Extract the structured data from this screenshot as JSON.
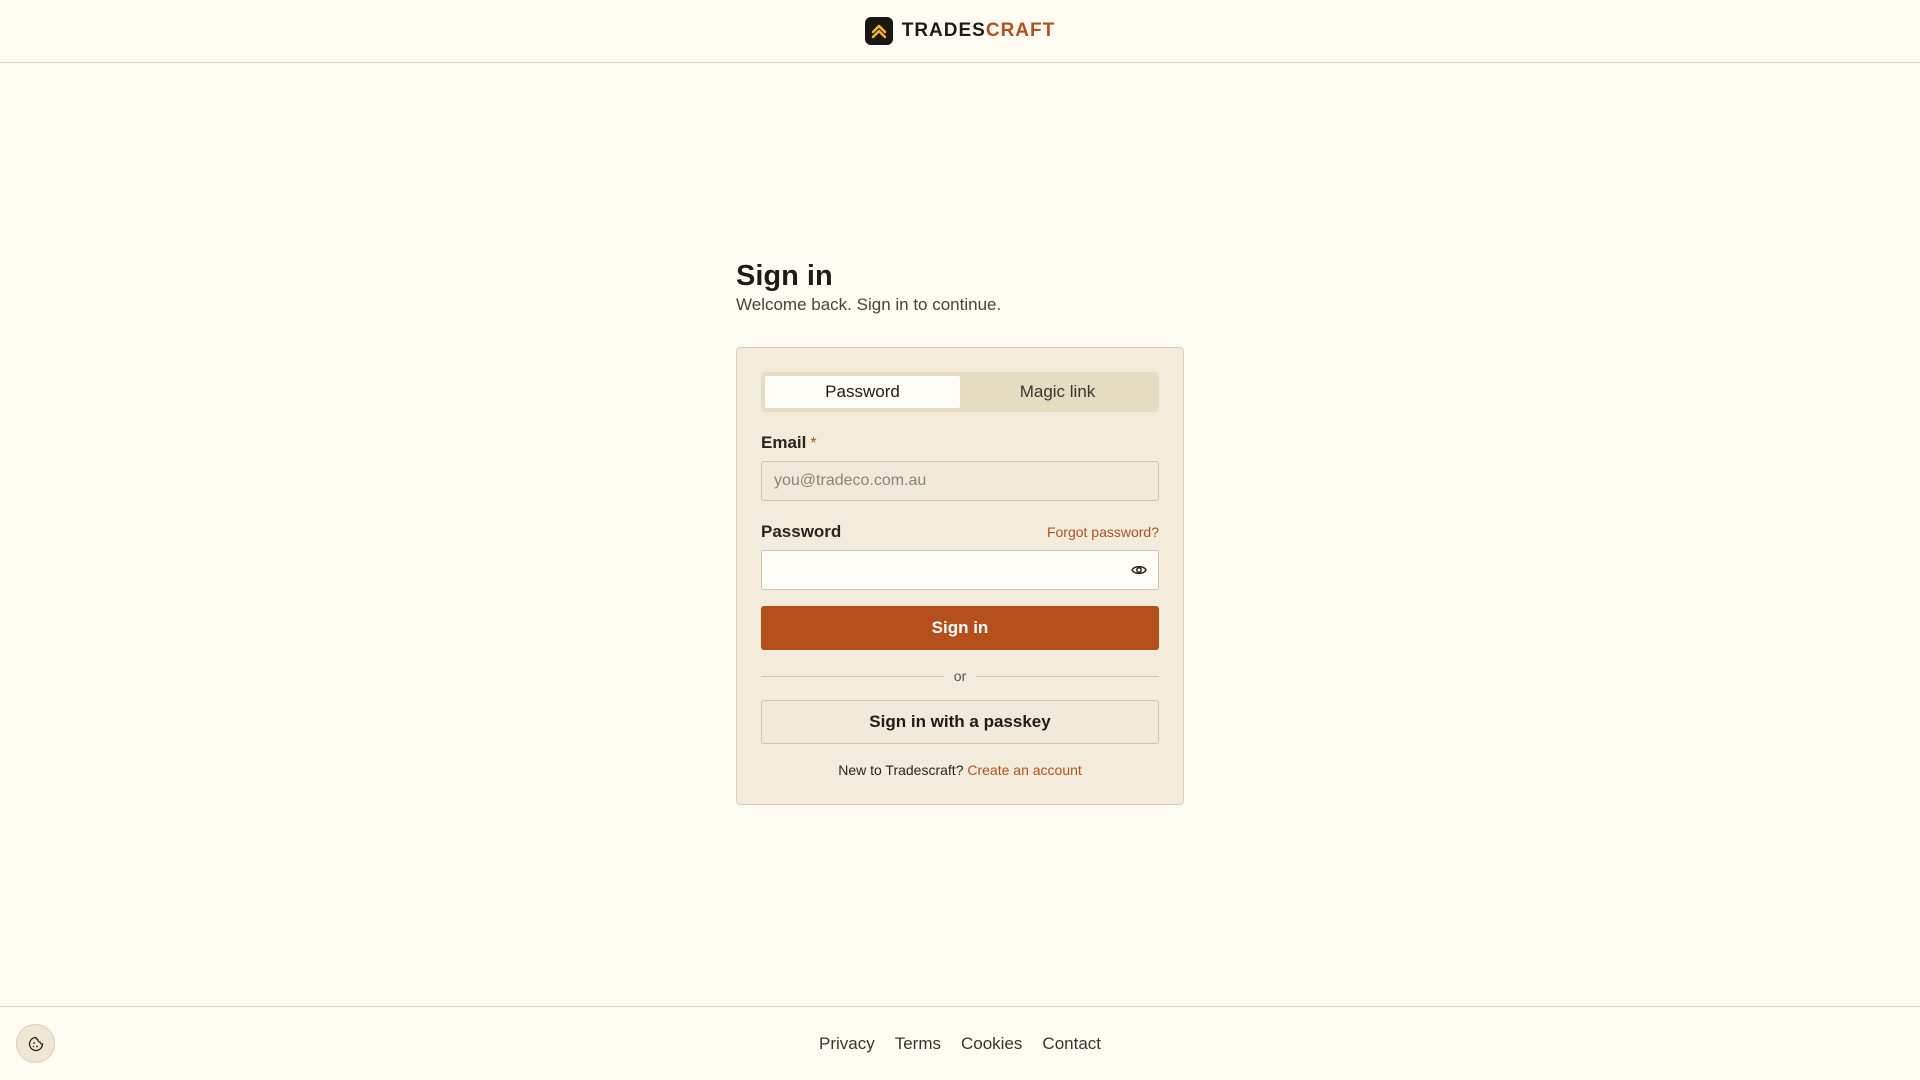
{
  "brand": {
    "part1": "TRADES",
    "part2": "CRAFT",
    "logo_icon": "chevron-up-icon"
  },
  "page": {
    "title": "Sign in",
    "subtitle": "Welcome back. Sign in to continue."
  },
  "tabs": [
    {
      "label": "Password",
      "active": true
    },
    {
      "label": "Magic link",
      "active": false
    }
  ],
  "form": {
    "email_label": "Email",
    "required_mark": "*",
    "email_placeholder": "you@tradeco.com.au",
    "email_value": "",
    "password_label": "Password",
    "forgot_label": "Forgot password?",
    "password_value": "",
    "show_password_icon": "eye-icon",
    "submit_label": "Sign in",
    "divider_label": "or",
    "passkey_label": "Sign in with a passkey",
    "signup_prompt": "New to Tradescraft?",
    "signup_link": "Create an account"
  },
  "footer": {
    "links": [
      "Privacy",
      "Terms",
      "Cookies",
      "Contact"
    ],
    "cookie_icon": "cookie-icon"
  },
  "colors": {
    "accent": "#b5501d",
    "background": "#fefbf3",
    "card": "#f3ecdc"
  }
}
